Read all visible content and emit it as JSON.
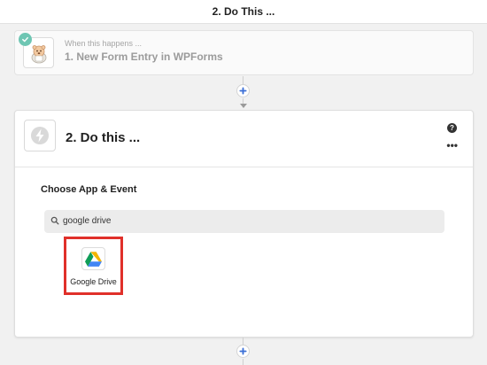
{
  "header": {
    "title": "2. Do This ..."
  },
  "trigger": {
    "kicker": "When this happens ...",
    "title": "1. New Form Entry in WPForms",
    "app_icon": "wpforms-bear-icon",
    "status_icon": "check-icon"
  },
  "action": {
    "title": "2. Do this ...",
    "app_icon": "lightning-icon",
    "help_label": "?",
    "more_label": "•••",
    "section_heading": "Choose App & Event",
    "search": {
      "value": "google drive",
      "icon": "search-icon"
    },
    "results": [
      {
        "label": "Google Drive",
        "icon": "google-drive-icon"
      }
    ]
  },
  "colors": {
    "accent": "#3b6fd6",
    "highlight_border": "#e0302a",
    "success": "#6ec6b3"
  }
}
